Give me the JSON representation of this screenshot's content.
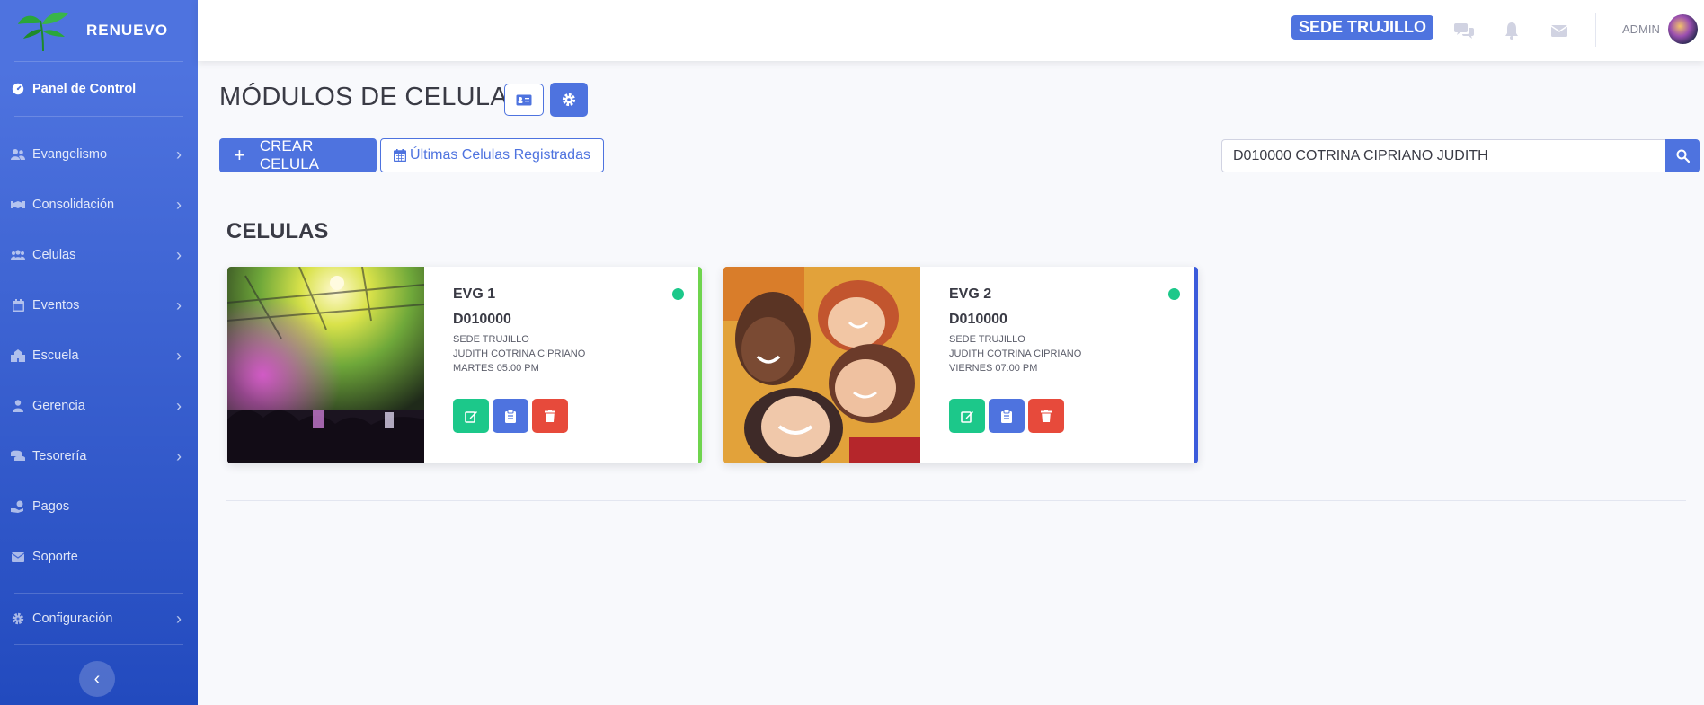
{
  "brand": {
    "name": "RENUEVO"
  },
  "sidebar": {
    "dashboard": {
      "label": "Panel de Control",
      "icon": "tachometer-icon"
    },
    "items": [
      {
        "label": "Evangelismo",
        "icon": "users-icon"
      },
      {
        "label": "Consolidación",
        "icon": "handshake-icon"
      },
      {
        "label": "Celulas",
        "icon": "group-icon"
      },
      {
        "label": "Eventos",
        "icon": "calendar-icon"
      },
      {
        "label": "Escuela",
        "icon": "school-icon"
      },
      {
        "label": "Gerencia",
        "icon": "user-tie-icon"
      },
      {
        "label": "Tesorería",
        "icon": "coins-icon"
      },
      {
        "label": "Pagos",
        "icon": "hand-money-icon"
      },
      {
        "label": "Soporte",
        "icon": "envelope-icon"
      }
    ],
    "settings": {
      "label": "Configuración",
      "icon": "gear-icon"
    }
  },
  "topbar": {
    "sede": "SEDE TRUJILLO",
    "user": "ADMIN"
  },
  "main": {
    "title": "MÓDULOS DE CELULAS",
    "crear_label": "CREAR CELULA",
    "ultimas_label": "Últimas Celulas Registradas",
    "search_value": "D010000 COTRINA CIPRIANO JUDITH",
    "section_title": "CELULAS"
  },
  "cells": [
    {
      "name": "EVG 1",
      "code": "D010000",
      "sede": "SEDE TRUJILLO",
      "leader": "JUDITH COTRINA CIPRIANO",
      "schedule": "MARTES 05:00 PM",
      "status": "active",
      "accent": "#6fd44e"
    },
    {
      "name": "EVG 2",
      "code": "D010000",
      "sede": "SEDE TRUJILLO",
      "leader": "JUDITH COTRINA CIPRIANO",
      "schedule": "VIERNES 07:00 PM",
      "status": "active",
      "accent": "#3b5bdb"
    }
  ],
  "colors": {
    "primary": "#4e73df",
    "success": "#1cc88a",
    "danger": "#e74a3b"
  }
}
